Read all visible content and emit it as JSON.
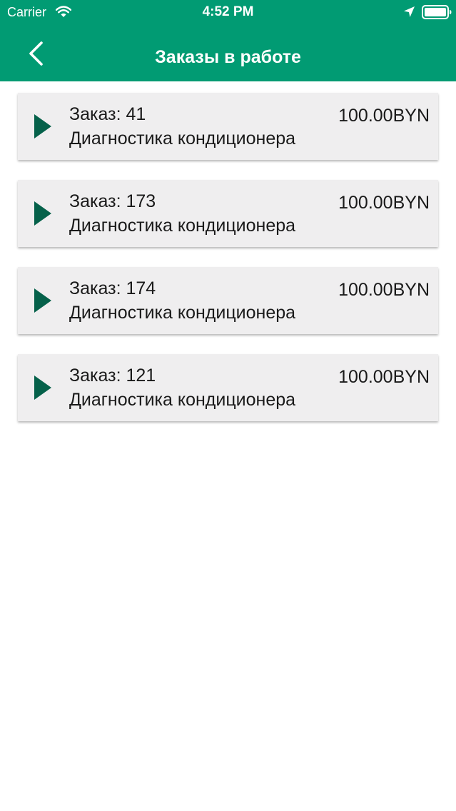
{
  "status_bar": {
    "carrier": "Carrier",
    "time": "4:52 PM"
  },
  "icons": {
    "wifi": "wifi-icon",
    "location": "location-arrow-icon",
    "battery": "battery-icon",
    "back": "chevron-left-icon",
    "play": "play-triangle-icon"
  },
  "colors": {
    "header": "#019b73",
    "card_background": "#efeeef",
    "play_icon": "#05614a",
    "text": "#1a1a1a"
  },
  "nav": {
    "title": "Заказы в работе"
  },
  "orders": [
    {
      "number_label": "Заказ: 41",
      "service": "Диагностика кондиционера",
      "price": "100.00BYN"
    },
    {
      "number_label": "Заказ: 173",
      "service": "Диагностика кондиционера",
      "price": "100.00BYN"
    },
    {
      "number_label": "Заказ: 174",
      "service": "Диагностика кондиционера",
      "price": "100.00BYN"
    },
    {
      "number_label": "Заказ: 121",
      "service": "Диагностика кондиционера",
      "price": "100.00BYN"
    }
  ]
}
